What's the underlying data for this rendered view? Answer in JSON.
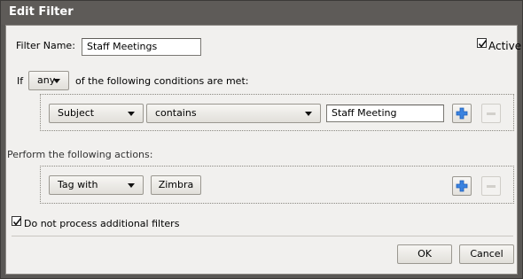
{
  "dialog": {
    "title": "Edit Filter",
    "filter_name_label": "Filter Name:",
    "filter_name_value": "Staff Meetings",
    "active_label": "Active",
    "active_checked": true,
    "if_label": "If",
    "match_select": "any",
    "conditions_suffix": "of the following conditions are met:",
    "condition": {
      "field": "Subject",
      "operator": "contains",
      "value": "Staff Meeting"
    },
    "actions_label": "Perform the following actions:",
    "action": {
      "type": "Tag with",
      "tag_button": "Zimbra"
    },
    "stop_label": "Do not process additional filters",
    "stop_checked": true,
    "ok_label": "OK",
    "cancel_label": "Cancel"
  },
  "icons": {
    "add": "plus-icon",
    "remove": "minus-icon",
    "dropdown": "chevron-down-icon",
    "check": "checkmark-icon"
  },
  "colors": {
    "titlebar": "#5e5b58",
    "panel": "#f1f0ee",
    "plus_blue": "#2b6fcf"
  }
}
